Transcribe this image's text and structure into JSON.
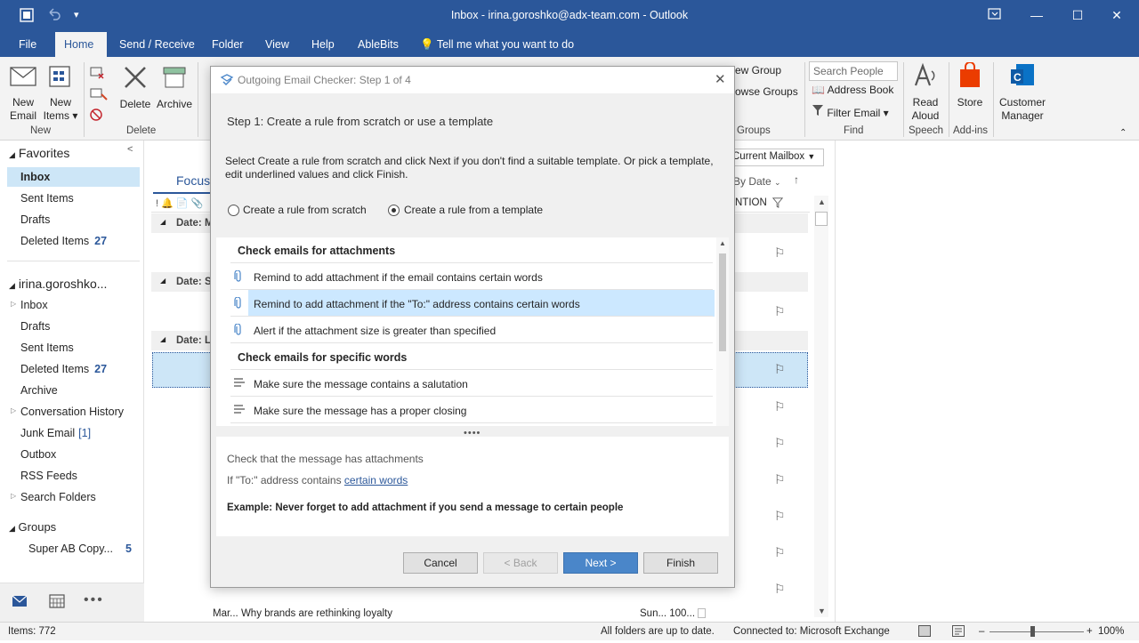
{
  "window": {
    "title": "Inbox - irina.goroshko@adx-team.com  -  Outlook"
  },
  "tabs": [
    "File",
    "Home",
    "Send / Receive",
    "Folder",
    "View",
    "Help",
    "AbleBits"
  ],
  "tell_me": "Tell me what you want to do",
  "ribbon": {
    "new_email": [
      "New",
      "Email"
    ],
    "new_items": [
      "New",
      "Items ▾"
    ],
    "delete": "Delete",
    "archive": "Archive",
    "group_new": "New",
    "group_delete": "Delete",
    "new_group": "ew Group",
    "browse_groups": "owse Groups",
    "group_groups": "Groups",
    "search_people": "Search People",
    "address_book": "Address Book",
    "filter_email": "Filter Email ▾",
    "group_find": "Find",
    "read_aloud": [
      "Read",
      "Aloud"
    ],
    "group_speech": "Speech",
    "store": "Store",
    "group_addins": "Add-ins",
    "customer_manager": [
      "Customer",
      "Manager"
    ]
  },
  "nav": {
    "favorites": "Favorites",
    "fav_items": [
      {
        "label": "Inbox",
        "count": ""
      },
      {
        "label": "Sent Items",
        "count": ""
      },
      {
        "label": "Drafts",
        "count": ""
      },
      {
        "label": "Deleted Items",
        "count": "27"
      }
    ],
    "account": "irina.goroshko...",
    "acct_items": [
      {
        "label": "Inbox",
        "count": ""
      },
      {
        "label": "Drafts",
        "count": ""
      },
      {
        "label": "Sent Items",
        "count": ""
      },
      {
        "label": "Deleted Items",
        "count": "27"
      },
      {
        "label": "Archive",
        "count": ""
      },
      {
        "label": "Conversation History",
        "count": ""
      },
      {
        "label": "Junk Email",
        "count": "[1]"
      },
      {
        "label": "Outbox",
        "count": ""
      },
      {
        "label": "RSS Feeds",
        "count": ""
      },
      {
        "label": "Search Folders",
        "count": ""
      }
    ],
    "groups": "Groups",
    "group_items": [
      {
        "label": "Super AB Copy...",
        "count": "5"
      }
    ]
  },
  "list": {
    "focused_tab": "Focuse",
    "scope": "Current Mailbox",
    "sort": "By Date",
    "mention_col": "NTION",
    "date_heads": [
      "Date: M",
      "Date: S",
      "Date: La"
    ],
    "last_row": {
      "subject": "Mar... Why brands are rethinking loyalty",
      "date": "Sun... 100..."
    }
  },
  "dialog": {
    "title": "Outgoing Email Checker: Step 1 of 4",
    "step": "Step 1: Create a rule from scratch or use a template",
    "instructions": "Select Create a rule from scratch and click Next if you don't find a suitable template. Or pick a template, edit underlined values and click Finish.",
    "radio_scratch": "Create a rule from scratch",
    "radio_template": "Create a rule from a template",
    "selected_radio": "template",
    "categories": [
      {
        "name": "Check emails for attachments",
        "items": [
          "Remind to add attachment if the email contains certain words",
          "Remind to add attachment if the \"To:\" address contains certain words",
          "Alert if the attachment size is greater than specified"
        ]
      },
      {
        "name": "Check emails for specific words",
        "items": [
          "Make sure the message contains a salutation",
          "Make sure the message has a proper closing"
        ]
      }
    ],
    "desc_line1": "Check that the message has attachments",
    "desc_line2_prefix": "If \"To:\" address contains ",
    "desc_line2_link": "certain words",
    "example": "Example: Never forget to add attachment if you send a message to certain people",
    "buttons": {
      "cancel": "Cancel",
      "back": "< Back",
      "next": "Next >",
      "finish": "Finish"
    }
  },
  "status": {
    "items": "Items: 772",
    "sync": "All folders are up to date.",
    "connection": "Connected to: Microsoft Exchange",
    "zoom": "100%"
  },
  "colors": {
    "accent": "#2b579a",
    "selection": "#cde6f7",
    "primary_button": "#4a86c9"
  }
}
